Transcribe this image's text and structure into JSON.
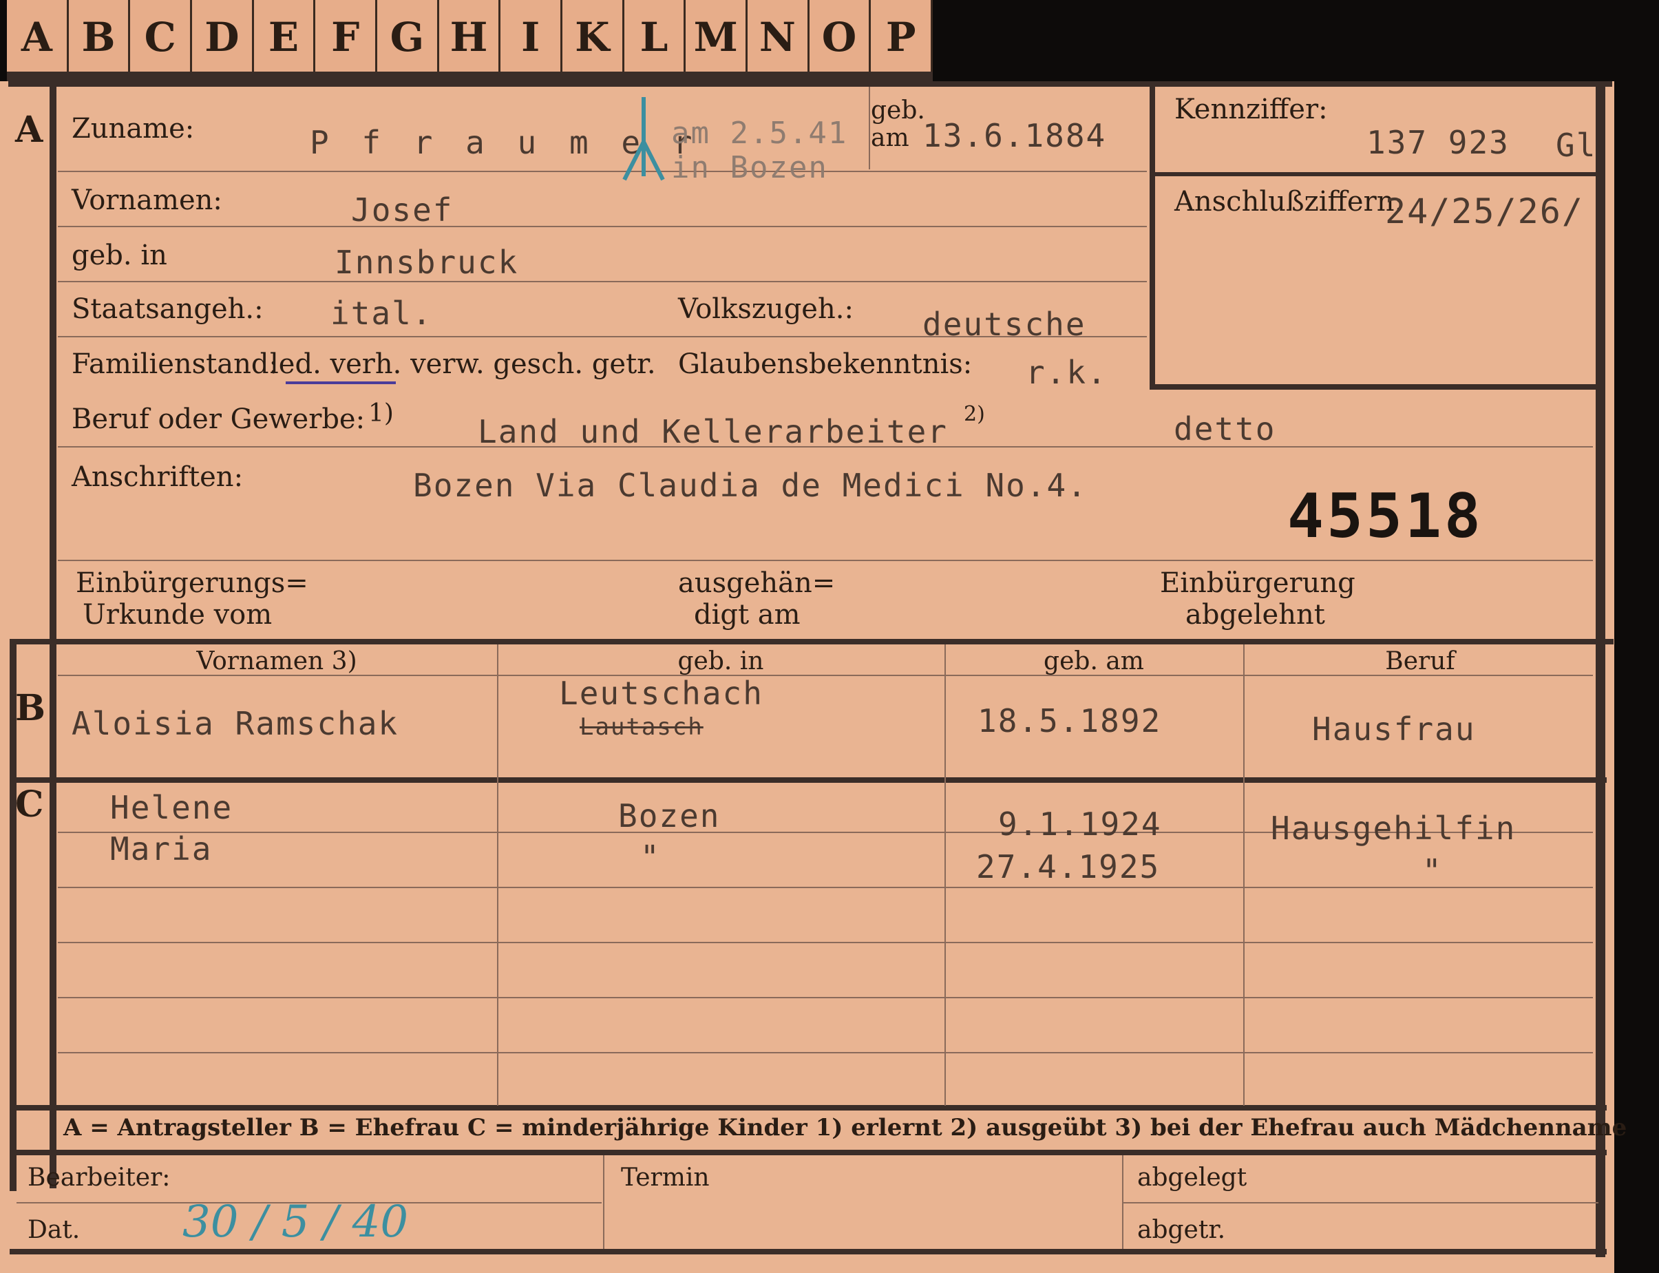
{
  "tabs": [
    "A",
    "B",
    "C",
    "D",
    "E",
    "F",
    "G",
    "H",
    "I",
    "K",
    "L",
    "M",
    "N",
    "O",
    "P"
  ],
  "section_a": {
    "marker": "A",
    "zuname_label": "Zuname:",
    "zuname_value": "P f r a u m e r",
    "death_note_line1": "am 2.5.41",
    "death_note_line2": "in Bozen",
    "geb_am_label_1": "geb.",
    "geb_am_label_2": "am",
    "geb_am_value": "13.6.1884",
    "kennziffer_label": "Kennziffer:",
    "kennziffer_value": "137 923",
    "kennziffer_suffix": "Gl",
    "anschluss_label": "Anschlußziffern:",
    "anschluss_value": "24/25/26/",
    "vornamen_label": "Vornamen:",
    "vornamen_value": "Josef",
    "geb_in_label": "geb. in",
    "geb_in_value": "Innsbruck",
    "staat_label": "Staatsangeh.:",
    "staat_value": "ital.",
    "volk_label": "Volkszugeh.:",
    "volk_value": "deutsche",
    "familienstand_label": "Familienstand:",
    "familienstand_options": "led. verh. verw. gesch. getr.",
    "glaube_label": "Glaubensbekenntnis:",
    "glaube_value": "r.k.",
    "beruf_label": "Beruf oder Gewerbe:",
    "beruf_fn1": "1)",
    "beruf_value": "Land und Kellerarbeiter",
    "beruf_fn2": "2)",
    "beruf_value2": "detto",
    "anschrift_label": "Anschriften:",
    "anschrift_value": "Bozen Via Claudia de Medici No.4.",
    "stamp_number": "45518",
    "einb_urkunde_1": "Einbürgerungs=",
    "einb_urkunde_2": "Urkunde vom",
    "ausgeh_1": "ausgehän=",
    "ausgeh_2": "digt am",
    "einb_abgel_1": "Einbürgerung",
    "einb_abgel_2": "abgelehnt"
  },
  "section_b": {
    "marker": "B",
    "headers": [
      "Vornamen 3)",
      "geb. in",
      "geb. am",
      "Beruf"
    ],
    "name": "Aloisia Ramschak",
    "geb_in": "Leutschach",
    "geb_in_struck": "Lautasch",
    "geb_am": "18.5.1892",
    "beruf": "Hausfrau"
  },
  "section_c": {
    "marker": "C",
    "rows": [
      {
        "name": "Helene",
        "geb_in": "Bozen",
        "geb_am": "9.1.1924",
        "beruf": "Hausgehilfin"
      },
      {
        "name": "Maria",
        "geb_in": "\"",
        "geb_am": "27.4.1925",
        "beruf": "\""
      }
    ]
  },
  "legend": "A = Antragsteller   B = Ehefrau   C = minderjährige Kinder   1) erlernt   2) ausgeübt   3) bei der Ehefrau auch Mädchenname",
  "footer": {
    "bearbeiter_label": "Bearbeiter:",
    "dat_label": "Dat.",
    "dat_value": "30 / 5 / 40",
    "termin_label": "Termin",
    "abgelegt_label": "abgelegt",
    "abgetr_label": "abgetr."
  }
}
